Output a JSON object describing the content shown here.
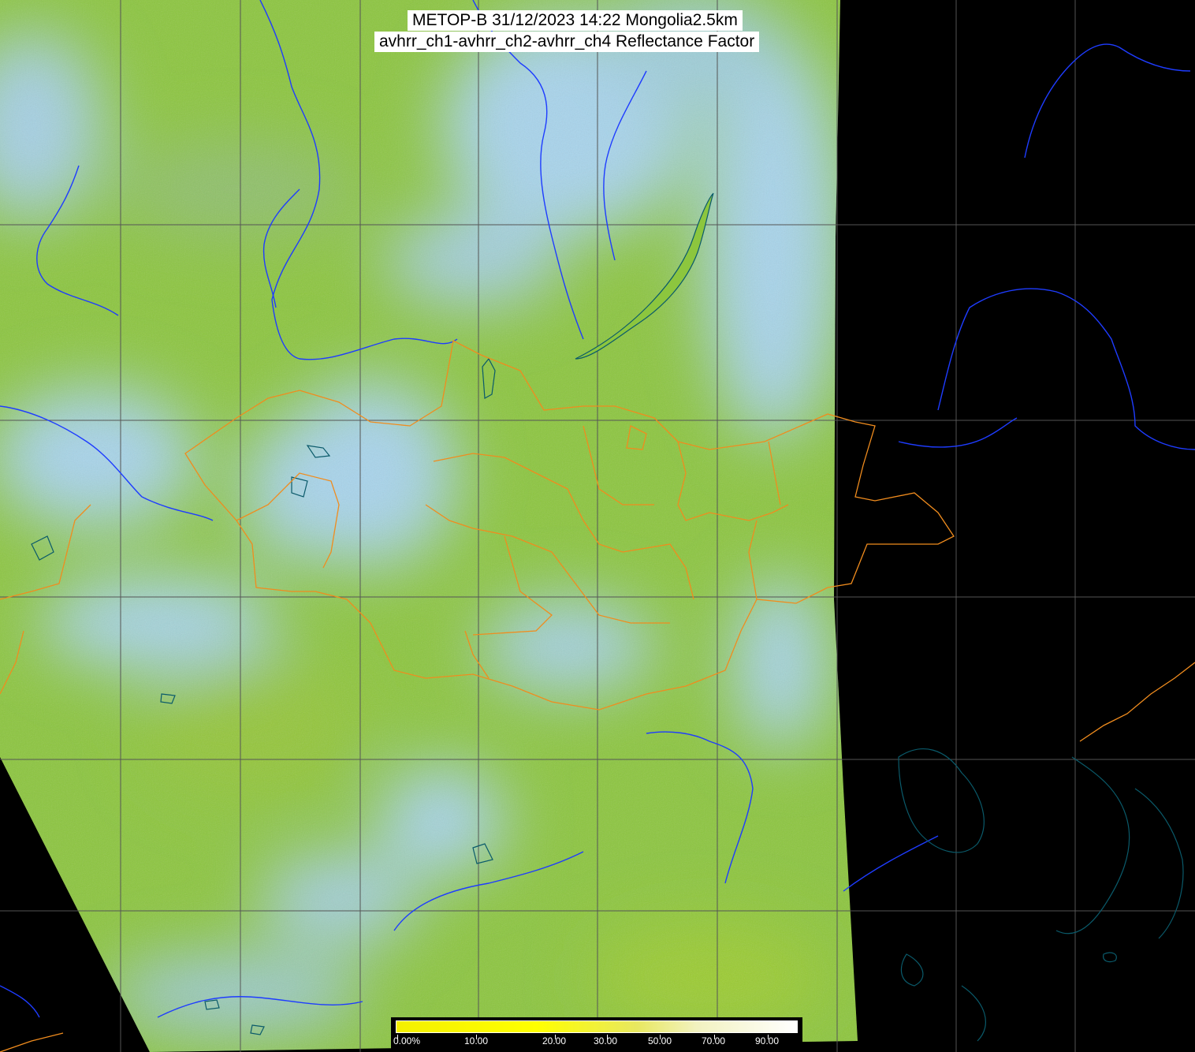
{
  "title": {
    "line1": "METOP-B 31/12/2023 14:22 Mongolia2.5km",
    "line2": "avhrr_ch1-avhrr_ch2-avhrr_ch4 Reflectance Factor"
  },
  "legend": {
    "tick_labels": [
      "0.00%",
      "10.00",
      "20.00",
      "30.00",
      "50.00",
      "70.00",
      "90.00"
    ]
  },
  "colors": {
    "background": "#000000",
    "land_green": "#8cc63e",
    "cloud_blue": "#a8d4ec",
    "rivers": "#1e3cff",
    "coastline_lakes": "#0a5a6a",
    "admin_borders": "#f08c1e",
    "graticule": "#555555"
  }
}
